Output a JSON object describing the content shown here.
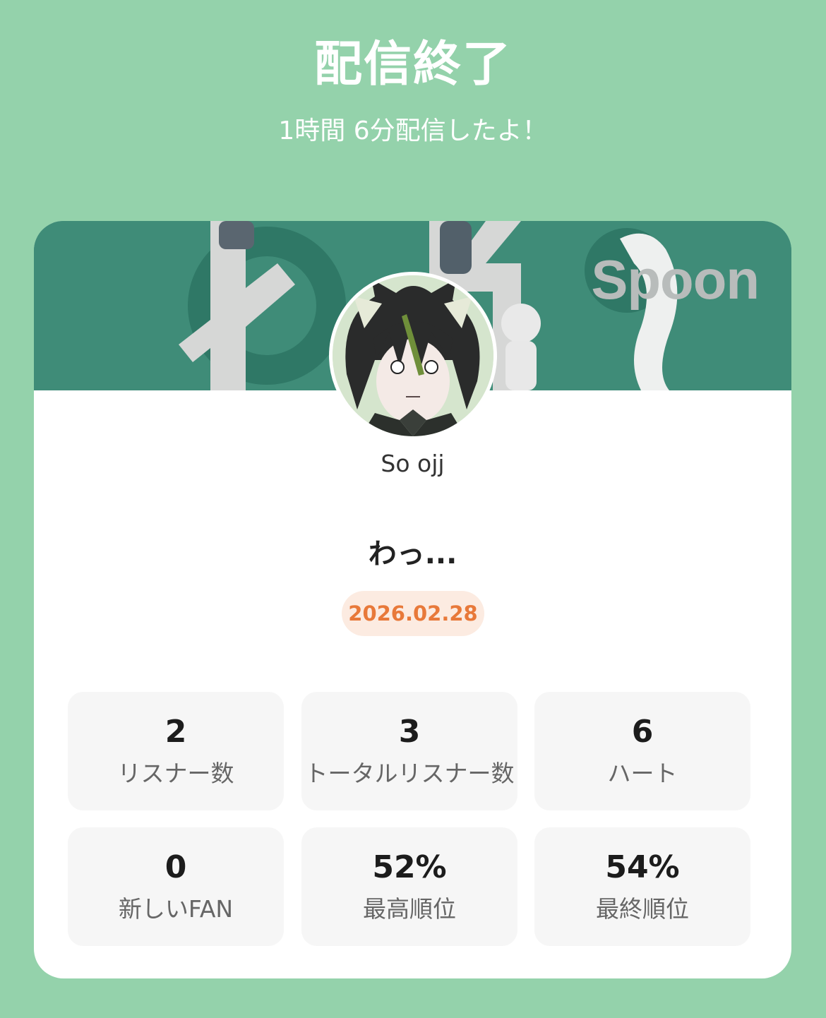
{
  "header": {
    "title": "配信終了",
    "subtitle": "1時間 6分配信したよ！"
  },
  "card": {
    "brand": "Spoon",
    "username": "So ojj",
    "stream_title": "わっ...",
    "date": "2026.02.28"
  },
  "stats": [
    {
      "value": "2",
      "label": "リスナー数"
    },
    {
      "value": "3",
      "label": "トータルリスナー数"
    },
    {
      "value": "6",
      "label": "ハート"
    },
    {
      "value": "0",
      "label": "新しいFAN"
    },
    {
      "value": "52%",
      "label": "最高順位"
    },
    {
      "value": "54%",
      "label": "最終順位"
    }
  ],
  "colors": {
    "background": "#94d2ab",
    "banner": "#3f8c78",
    "date_text": "#e8793a",
    "date_bg": "#fcebe1"
  }
}
